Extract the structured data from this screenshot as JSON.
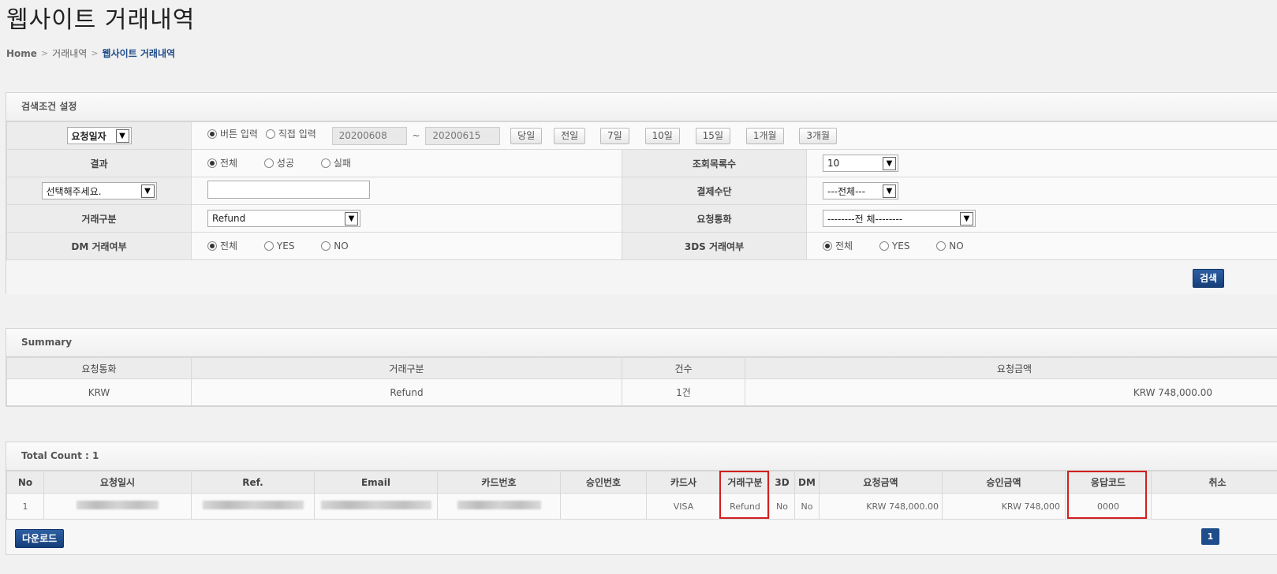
{
  "title": "웹사이트 거래내역",
  "breadcrumb": {
    "home": "Home",
    "level1": "거래내역",
    "current": "웹사이트 거래내역"
  },
  "search": {
    "header": "검색조건 설정",
    "date_type": "요청일자",
    "date_mode_button": "버튼 입력",
    "date_mode_direct": "직접 입력",
    "date_from": "20200608",
    "date_sep": "~",
    "date_to": "20200615",
    "quick": [
      "당일",
      "전일",
      "7일",
      "10일",
      "15일",
      "1개월",
      "3개월"
    ],
    "result_label": "결과",
    "result_options": [
      "전체",
      "성공",
      "실패"
    ],
    "list_count_label": "조회목록수",
    "list_count_value": "10",
    "field_select": "선택해주세요.",
    "pay_method_label": "결제수단",
    "pay_method_value": "---전체---",
    "trx_type_label": "거래구분",
    "trx_type_value": "Refund",
    "currency_label": "요청통화",
    "currency_value": "--------전 체--------",
    "dm_label": "DM 거래여부",
    "dm_options": [
      "전체",
      "YES",
      "NO"
    ],
    "threeds_label": "3DS 거래여부",
    "threeds_options": [
      "전체",
      "YES",
      "NO"
    ],
    "search_button": "검색"
  },
  "summary": {
    "header": "Summary",
    "columns": [
      "요청통화",
      "거래구분",
      "건수",
      "요청금액"
    ],
    "row": [
      "KRW",
      "Refund",
      "1건",
      "KRW 748,000.00"
    ]
  },
  "results": {
    "header": "Total Count : 1",
    "columns": [
      "No",
      "요청일시",
      "Ref.",
      "Email",
      "카드번호",
      "승인번호",
      "카드사",
      "거래구분",
      "3D",
      "DM",
      "요청금액",
      "승인금액",
      "응답코드",
      "취소"
    ],
    "row": {
      "no": "1",
      "card_company": "VISA",
      "trx_type": "Refund",
      "3d": "No",
      "dm": "No",
      "req_amount": "KRW 748,000.00",
      "appr_amount": "KRW 748,000",
      "resp_code": "0000"
    },
    "download_button": "다운로드",
    "page": "1"
  },
  "colors": {
    "accent": "#1f4d8b",
    "highlight": "#d11f1f"
  }
}
